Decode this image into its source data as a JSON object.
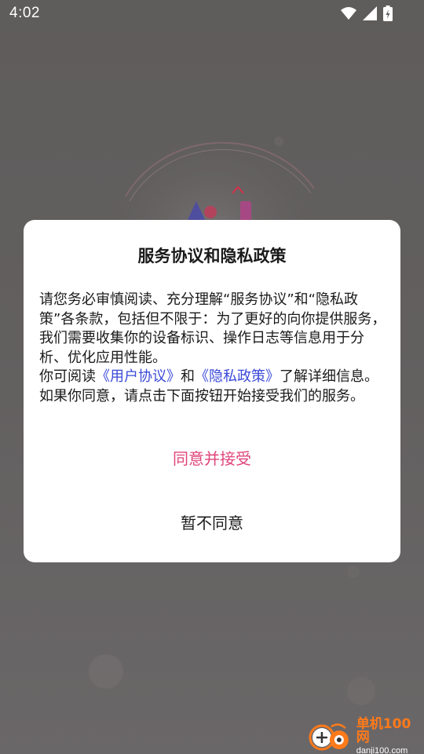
{
  "status_bar": {
    "time": "4:02",
    "icons": [
      "wifi-icon",
      "cellular-signal-icon",
      "battery-charging-icon"
    ]
  },
  "dialog": {
    "title": "服务协议和隐私政策",
    "paragraph1": "请您务必审慎阅读、充分理解“服务协议”和“隐私政策”各条款，包括但不限于：为了更好的向你提供服务，我们需要收集你的设备标识、操作日志等信息用于分析、优化应用性能。",
    "para2_prefix": "你可阅读",
    "user_agreement_link": "《用户协议》",
    "para2_and": "和",
    "privacy_policy_link": "《隐私政策》",
    "para2_suffix": "了解详细信息。如果你同意，请点击下面按钮开始接受我们的服务。",
    "agree_button": "同意并接受",
    "disagree_button": "暂不同意"
  },
  "watermark": {
    "title": "单机100网",
    "url": "danji100.com"
  },
  "colors": {
    "accent_pink": "#e0457b",
    "link_blue": "#3a49d8",
    "watermark_orange": "#ff7a1a",
    "overlay": "#625f5f"
  }
}
